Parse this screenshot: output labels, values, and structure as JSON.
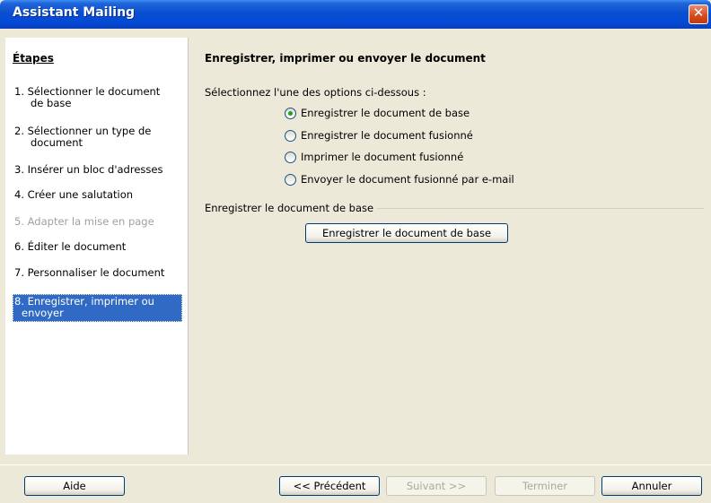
{
  "window": {
    "title": "Assistant Mailing",
    "close_glyph": "✕"
  },
  "steps": {
    "heading": "Étapes",
    "items": [
      {
        "label": "1.  Sélectionner le document",
        "label2": "     de base",
        "state": "normal"
      },
      {
        "label": "2.  Sélectionner un type de",
        "label2": "     document",
        "state": "normal"
      },
      {
        "label": "3.  Insérer un bloc d'adresses",
        "state": "normal"
      },
      {
        "label": "4.  Créer une salutation",
        "state": "normal"
      },
      {
        "label": "5.  Adapter la mise en page",
        "state": "disabled"
      },
      {
        "label": "6.  Éditer le document",
        "state": "normal"
      },
      {
        "label": "7.  Personnaliser le document",
        "state": "normal"
      },
      {
        "label": "8.  Enregistrer, imprimer ou",
        "label2": "     envoyer",
        "state": "active"
      }
    ]
  },
  "main": {
    "title": "Enregistrer, imprimer ou envoyer le document",
    "prompt": "Sélectionnez l'une des options ci-dessous :",
    "options": [
      {
        "label": "Enregistrer le document de base",
        "checked": true
      },
      {
        "label": "Enregistrer le document fusionné",
        "checked": false
      },
      {
        "label": "Imprimer le document fusionné",
        "checked": false
      },
      {
        "label": "Envoyer le document fusionné par e-mail",
        "checked": false
      }
    ],
    "group_label": "Enregistrer le document de base",
    "save_button": "Enregistrer le document de base"
  },
  "footer": {
    "help": "Aide",
    "previous": "<< Précédent",
    "next": "Suivant >>",
    "finish": "Terminer",
    "cancel": "Annuler"
  }
}
